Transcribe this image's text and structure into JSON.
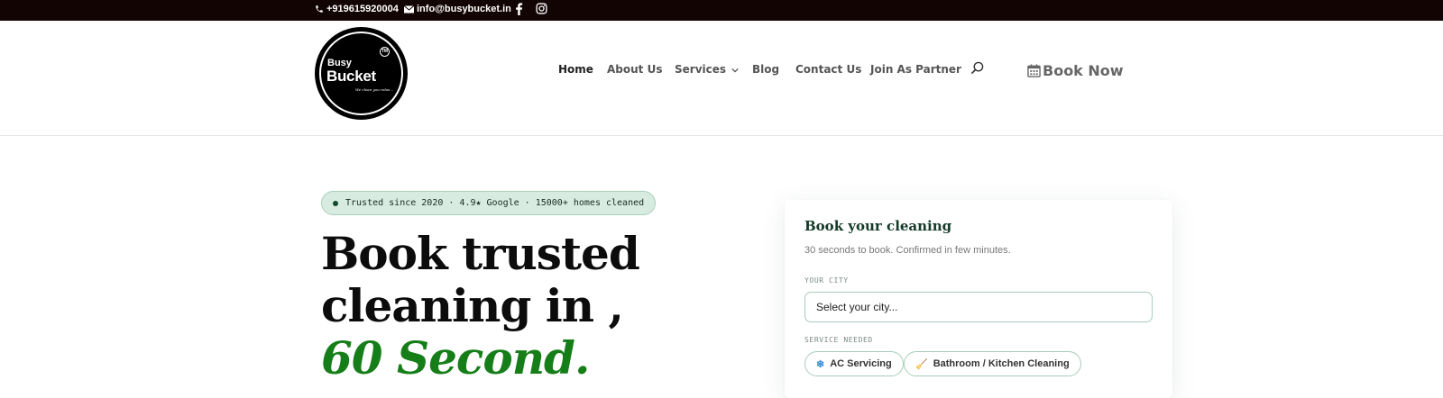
{
  "topbar": {
    "phone": "+919615920004",
    "email": "info@busybucket.in",
    "social": [
      "facebook-icon",
      "instagram-icon"
    ]
  },
  "logo": {
    "line1": "Busy",
    "line2": "Bucket",
    "tm": "TM",
    "tagline": "We clean you relax..."
  },
  "nav": {
    "items": [
      {
        "label": "Home",
        "active": true
      },
      {
        "label": "About Us"
      },
      {
        "label": "Services",
        "has_dropdown": true
      },
      {
        "label": "Blog"
      },
      {
        "label": "Contact Us"
      },
      {
        "label": "Join As Partner"
      }
    ],
    "book_now": "Book Now"
  },
  "hero": {
    "badge": "Trusted since 2020 · 4.9★ Google · 15000+ homes cleaned",
    "title_line1": "Book trusted",
    "title_line2": "cleaning in ,",
    "title_line3": "60 Second."
  },
  "booking": {
    "title": "Book your cleaning",
    "subtitle": "30 seconds to book. Confirmed in few minutes.",
    "city_label": "YOUR CITY",
    "city_placeholder": "Select your city...",
    "service_label": "SERVICE NEEDED",
    "services": [
      {
        "label": "AC Servicing",
        "icon": "❄"
      },
      {
        "label": "Bathroom / Kitchen Cleaning",
        "icon": "🧹"
      }
    ]
  },
  "colors": {
    "topbar_bg": "#120403",
    "accent_green": "#167e19",
    "card_title": "#143a28",
    "badge_bg": "#d7ebe1"
  }
}
